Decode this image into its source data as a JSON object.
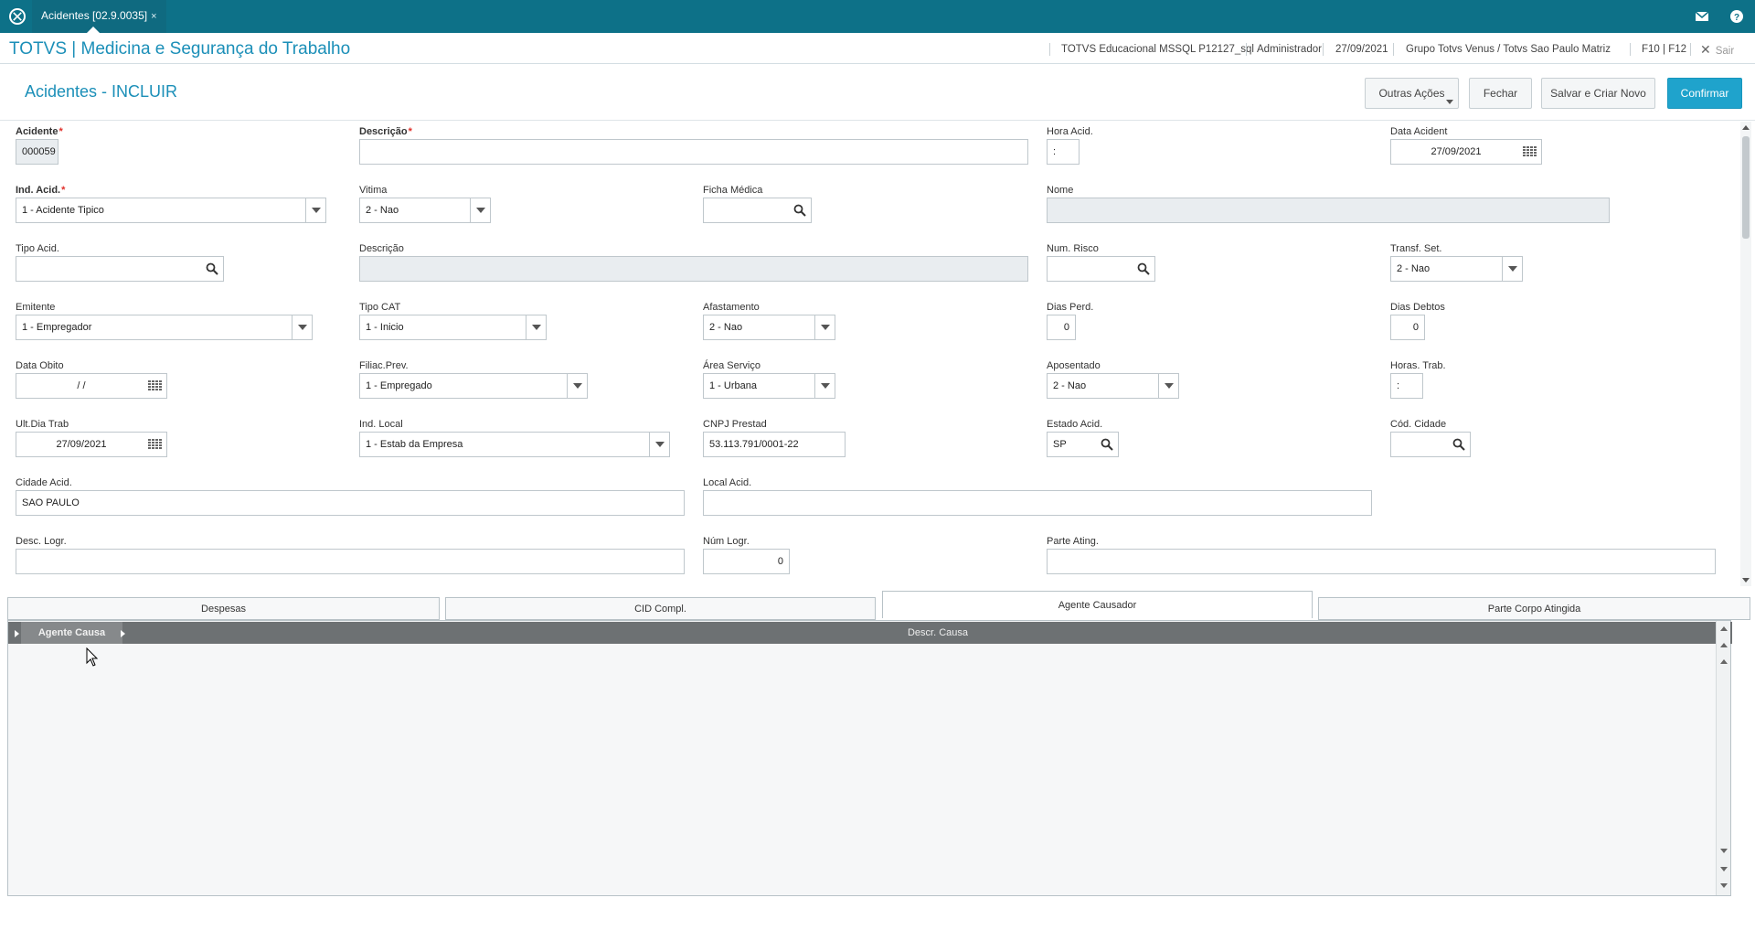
{
  "topbar": {
    "tab_title": "Acidentes [02.9.0035]",
    "tab_close": "×"
  },
  "header": {
    "app_title": "TOTVS | Medicina e Segurança do Trabalho",
    "environment": "TOTVS Educacional MSSQL P12127_sql",
    "user": "Administrador",
    "date": "27/09/2021",
    "company": "Grupo Totvs Venus / Totvs Sao Paulo Matriz",
    "shortcuts": "F10 | F12",
    "exit": "Sair"
  },
  "page": {
    "title": "Acidentes - INCLUIR",
    "buttons": {
      "more_actions": "Outras Ações",
      "close": "Fechar",
      "save_new": "Salvar e Criar Novo",
      "confirm": "Confirmar"
    }
  },
  "form": {
    "acidente": {
      "label": "Acidente",
      "value": "000059"
    },
    "descricao": {
      "label": "Descrição",
      "value": ""
    },
    "hora_acid": {
      "label": "Hora Acid.",
      "value": ":"
    },
    "data_acident": {
      "label": "Data Acident",
      "value": "27/09/2021"
    },
    "ind_acid": {
      "label": "Ind. Acid.",
      "value": "1 - Acidente Tipico"
    },
    "vitima": {
      "label": "Vitima",
      "value": "2 - Nao"
    },
    "ficha_medica": {
      "label": "Ficha Médica",
      "value": ""
    },
    "nome": {
      "label": "Nome",
      "value": ""
    },
    "tipo_acid": {
      "label": "Tipo Acid.",
      "value": ""
    },
    "descricao2": {
      "label": "Descrição",
      "value": ""
    },
    "num_risco": {
      "label": "Num. Risco",
      "value": ""
    },
    "transf_set": {
      "label": "Transf. Set.",
      "value": "2 - Nao"
    },
    "emitente": {
      "label": "Emitente",
      "value": "1 - Empregador"
    },
    "tipo_cat": {
      "label": "Tipo CAT",
      "value": "1 - Inicio"
    },
    "afastamento": {
      "label": "Afastamento",
      "value": "2 - Nao"
    },
    "dias_perd": {
      "label": "Dias Perd.",
      "value": "0"
    },
    "dias_debtos": {
      "label": "Dias Debtos",
      "value": "0"
    },
    "data_obito": {
      "label": "Data Obito",
      "value": "/ /"
    },
    "filiac_prev": {
      "label": "Filiac.Prev.",
      "value": "1 - Empregado"
    },
    "area_servico": {
      "label": "Área Serviço",
      "value": "1 - Urbana"
    },
    "aposentado": {
      "label": "Aposentado",
      "value": "2 - Nao"
    },
    "horas_trab": {
      "label": "Horas. Trab.",
      "value": ":"
    },
    "ult_dia_trab": {
      "label": "Ult.Dia Trab",
      "value": "27/09/2021"
    },
    "ind_local": {
      "label": "Ind. Local",
      "value": "1 - Estab da Empresa"
    },
    "cnpj_prestad": {
      "label": "CNPJ Prestad",
      "value": "53.113.791/0001-22"
    },
    "estado_acid": {
      "label": "Estado Acid.",
      "value": "SP"
    },
    "cod_cidade": {
      "label": "Cód. Cidade",
      "value": ""
    },
    "cidade_acid": {
      "label": "Cidade Acid.",
      "value": "SAO PAULO"
    },
    "local_acid": {
      "label": "Local Acid.",
      "value": ""
    },
    "desc_logr": {
      "label": "Desc. Logr.",
      "value": ""
    },
    "num_logr": {
      "label": "Núm Logr.",
      "value": "0"
    },
    "parte_ating": {
      "label": "Parte Ating.",
      "value": ""
    }
  },
  "tabs": [
    "Despesas",
    "CID Compl.",
    "Agente Causador",
    "Parte Corpo Atingida"
  ],
  "active_tab": "Agente Causador",
  "grid": {
    "columns": [
      "Agente Causa",
      "Descr. Causa"
    ],
    "rows": []
  },
  "colors": {
    "topbar": "#0d7188",
    "accent": "#1b8fb8",
    "primary_button": "#1fa3cc",
    "required": "#e0302a"
  }
}
